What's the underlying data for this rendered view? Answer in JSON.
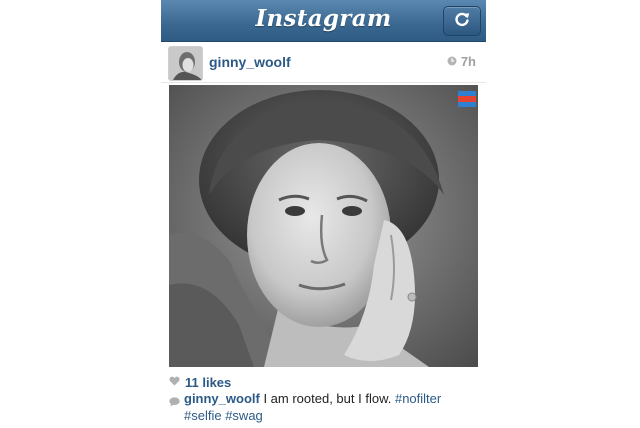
{
  "app": {
    "title": "Instagram"
  },
  "post": {
    "username": "ginny_woolf",
    "time": "7h",
    "likes": "11 likes",
    "caption": {
      "username": "ginny_woolf",
      "text": " I am rooted, but I flow. ",
      "hashtags": [
        "#nofilter",
        "#selfie",
        "#swag"
      ]
    }
  },
  "icons": {
    "refresh": "refresh-icon",
    "clock": "clock-icon",
    "heart": "heart-icon",
    "comment": "comment-bubble-icon",
    "photo_badge": "photo-map-badge-icon"
  },
  "colors": {
    "topbar": "#3a6891",
    "link": "#2c5a86",
    "muted": "#a0a0a0"
  }
}
